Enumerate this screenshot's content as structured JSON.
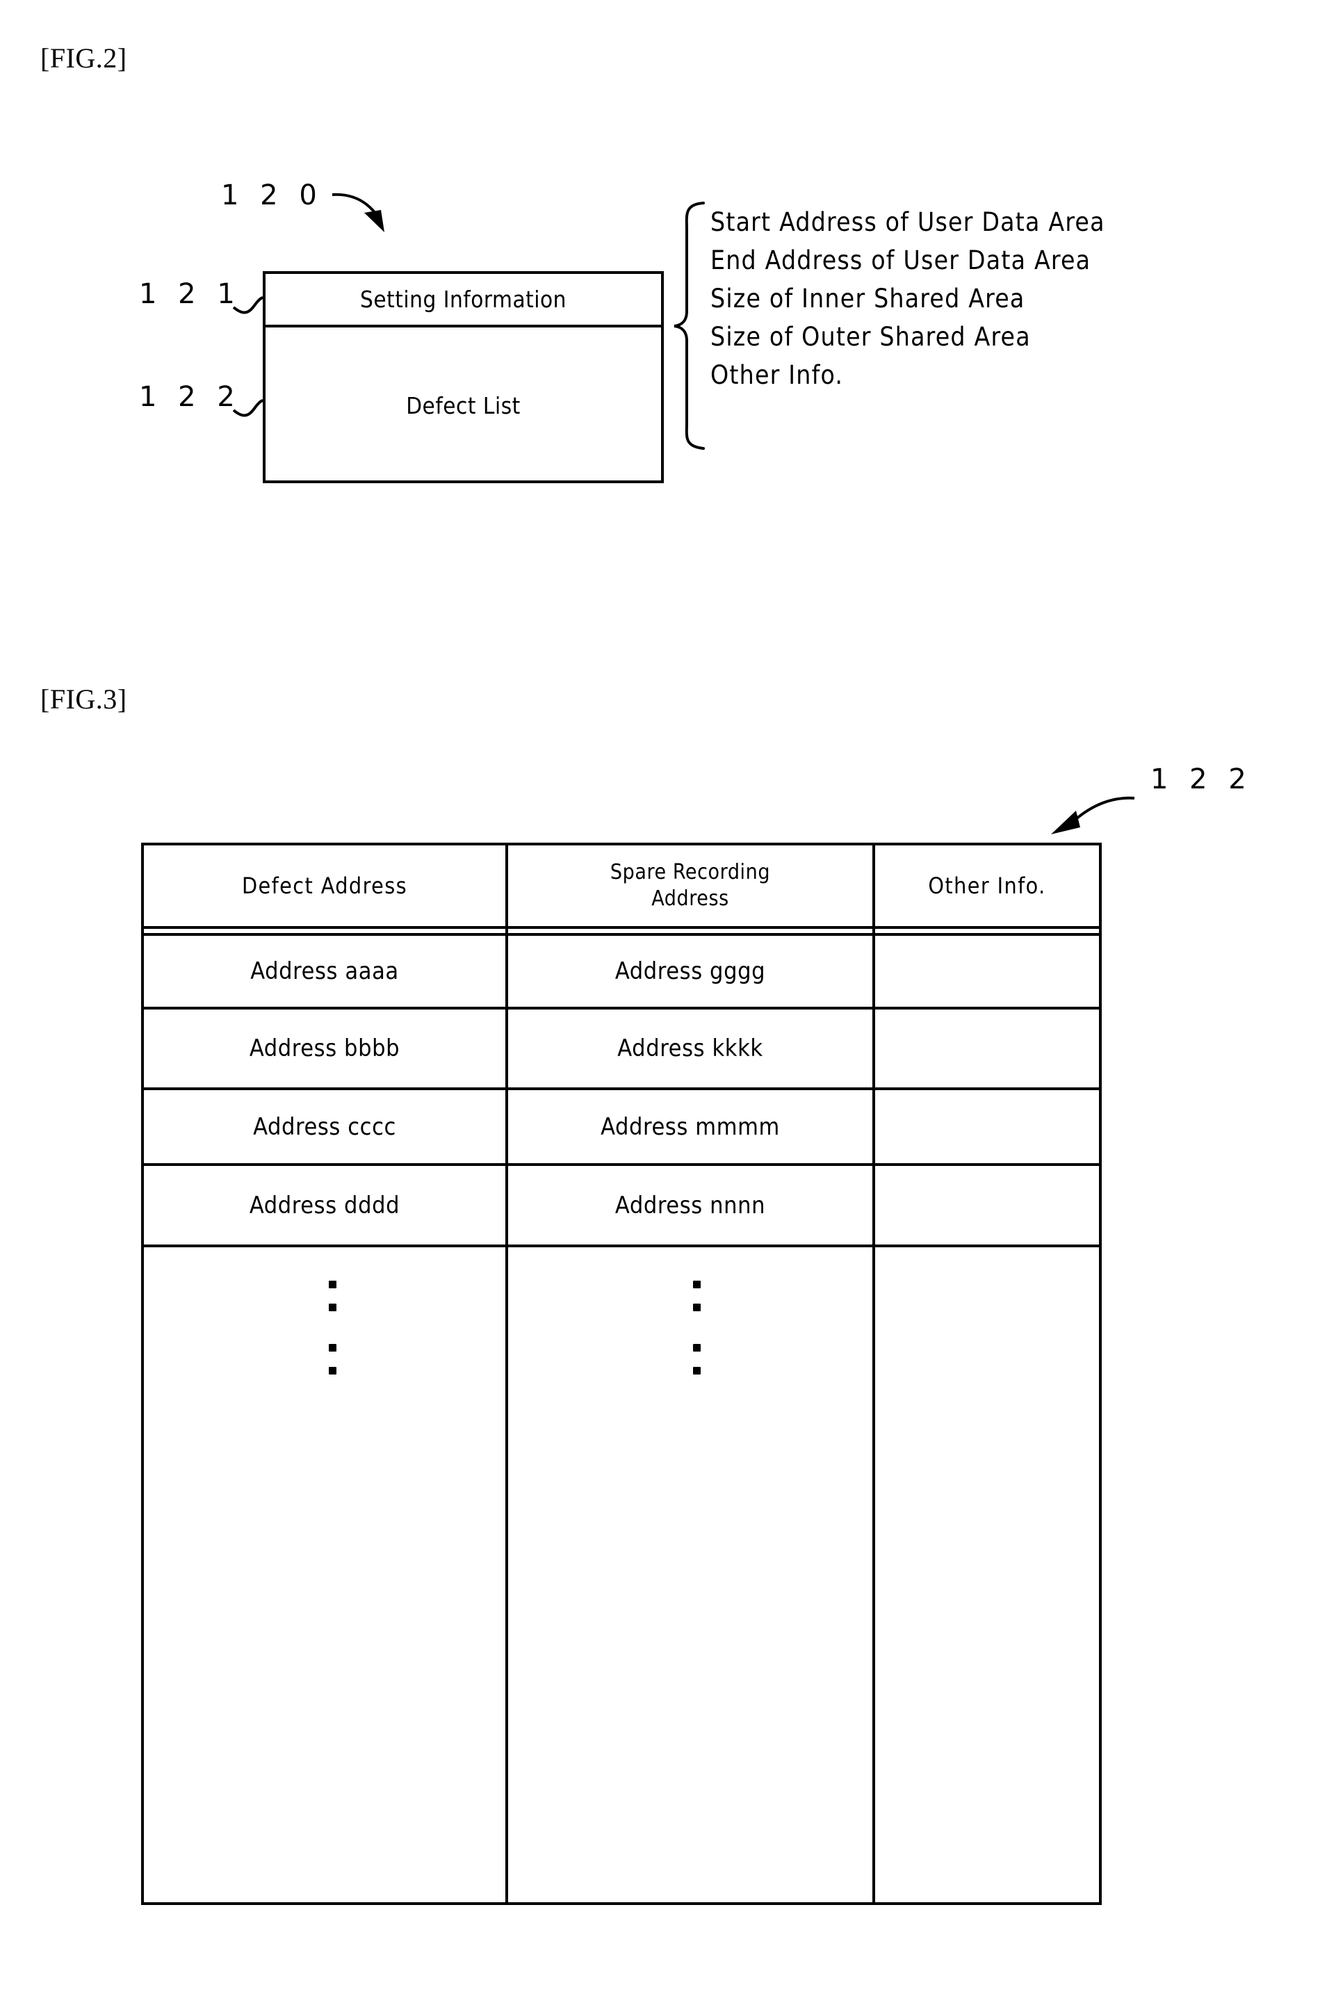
{
  "figures": {
    "fig2": {
      "label": "[FIG.2]",
      "ref_main": "1 2 0",
      "blocks": [
        {
          "ref": "1 2 1",
          "label": "Setting Information"
        },
        {
          "ref": "1 2 2",
          "label": "Defect List"
        }
      ],
      "setting_info_items": [
        "Start Address of User Data Area",
        "End Address of User Data Area",
        "Size of Inner Shared Area",
        "Size of Outer Shared Area",
        "Other Info."
      ]
    },
    "fig3": {
      "label": "[FIG.3]",
      "ref_main": "1 2 2",
      "table": {
        "headers": [
          "Defect Address",
          "Spare Recording\nAddress",
          "Other Info."
        ],
        "header_lines": {
          "col1": "Defect Address",
          "col2_line1": "Spare Recording",
          "col2_line2": "Address",
          "col3": "Other Info."
        },
        "rows": [
          {
            "defect_address": "Address aaaa",
            "spare_recording_address": "Address gggg",
            "other_info": ""
          },
          {
            "defect_address": "Address bbbb",
            "spare_recording_address": "Address kkkk",
            "other_info": ""
          },
          {
            "defect_address": "Address cccc",
            "spare_recording_address": "Address mmmm",
            "other_info": ""
          },
          {
            "defect_address": "Address dddd",
            "spare_recording_address": "Address nnnn",
            "other_info": ""
          }
        ],
        "continuation_marker": "vertical-ellipsis"
      }
    }
  },
  "colors": {
    "ink": "#000000",
    "paper": "#ffffff"
  }
}
